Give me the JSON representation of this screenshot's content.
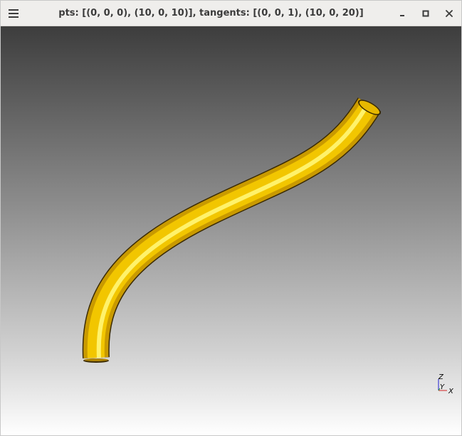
{
  "window": {
    "title": "pts: [(0, 0, 0), (10, 0, 10)], tangents: [(0, 0, 1), (10, 0, 20)]"
  },
  "titlebar": {
    "menu_icon": "hamburger-menu-icon",
    "minimize_icon": "minimize-icon",
    "maximize_icon": "maximize-icon",
    "close_icon": "close-icon"
  },
  "viewport": {
    "background_top": "#3d3d3d",
    "background_bottom": "#ffffff",
    "shape_color": "#f2c600"
  },
  "triad": {
    "z_label": "Z",
    "y_label": "Y",
    "x_label": "X",
    "x_color": "#d22020",
    "y_color": "#20a020",
    "z_color": "#2020d2"
  }
}
